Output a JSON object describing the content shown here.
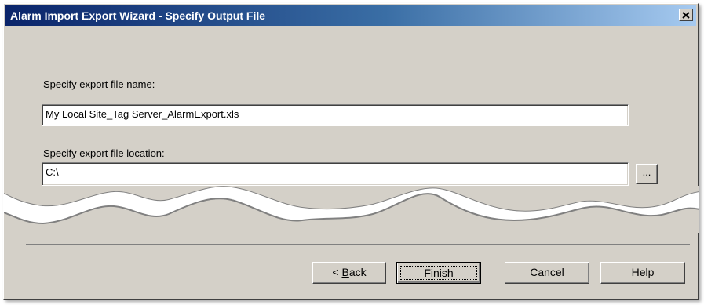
{
  "window": {
    "title": "Alarm Import Export Wizard - Specify Output File",
    "close_glyph": "×"
  },
  "form": {
    "file_name_label": "Specify export file name:",
    "file_name_value": "My Local Site_Tag Server_AlarmExport.xls",
    "file_location_label": "Specify export file location:",
    "file_location_value": "C:\\",
    "browse_label": "..."
  },
  "buttons": {
    "back_prefix": "< ",
    "back_mnemonic": "B",
    "back_rest": "ack",
    "finish": "Finish",
    "cancel": "Cancel",
    "help": "Help"
  },
  "icons": [
    "close-icon",
    "torn-edge"
  ],
  "colors": {
    "titlebar_start": "#0a246a",
    "titlebar_end": "#a6caf0",
    "face": "#d4d0c8"
  }
}
